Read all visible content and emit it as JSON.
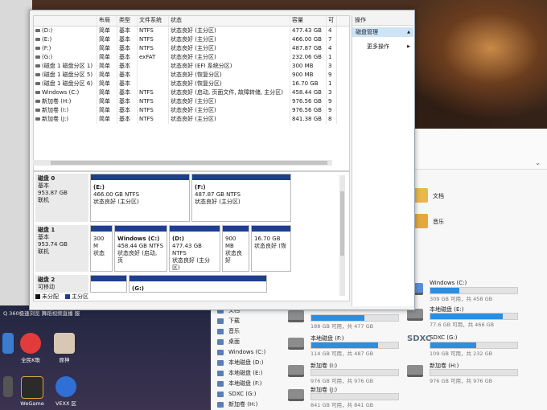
{
  "volumes": {
    "columns": [
      "",
      "布局",
      "类型",
      "文件系统",
      "状态",
      "容量",
      "可"
    ],
    "rows": [
      [
        "(D:)",
        "简单",
        "基本",
        "NTFS",
        "状态良好 (主分区)",
        "477.43 GB",
        "4"
      ],
      [
        "(E:)",
        "简单",
        "基本",
        "NTFS",
        "状态良好 (主分区)",
        "466.00 GB",
        "7"
      ],
      [
        "(F:)",
        "简单",
        "基本",
        "NTFS",
        "状态良好 (主分区)",
        "487.87 GB",
        "4"
      ],
      [
        "(G:)",
        "简单",
        "基本",
        "exFAT",
        "状态良好 (主分区)",
        "232.06 GB",
        "1"
      ],
      [
        "(磁盘 1 磁盘分区 1)",
        "简单",
        "基本",
        "",
        "状态良好 (EFI 系统分区)",
        "300 MB",
        "3"
      ],
      [
        "(磁盘 1 磁盘分区 5)",
        "简单",
        "基本",
        "",
        "状态良好 (恢复分区)",
        "900 MB",
        "9"
      ],
      [
        "(磁盘 1 磁盘分区 6)",
        "简单",
        "基本",
        "",
        "状态良好 (恢复分区)",
        "16.70 GB",
        "1"
      ],
      [
        "Windows (C:)",
        "简单",
        "基本",
        "NTFS",
        "状态良好 (启动, 页面文件, 故障转储, 主分区)",
        "458.44 GB",
        "3"
      ],
      [
        "新加卷 (H:)",
        "简单",
        "基本",
        "NTFS",
        "状态良好 (主分区)",
        "976.56 GB",
        "9"
      ],
      [
        "新加卷 (I:)",
        "简单",
        "基本",
        "NTFS",
        "状态良好 (主分区)",
        "976.56 GB",
        "9"
      ],
      [
        "新加卷 (J:)",
        "简单",
        "基本",
        "NTFS",
        "状态良好 (主分区)",
        "841.38 GB",
        "8"
      ]
    ]
  },
  "ops": {
    "header": "操作",
    "selected": "磁盘管理",
    "more": "更多操作"
  },
  "disks": {
    "d0": {
      "name": "磁盘 0",
      "type": "基本",
      "size": "953.87 GB",
      "status": "联机",
      "p1": {
        "label": "(E:)",
        "size": "466.00 GB NTFS",
        "status": "状态良好 (主分区)"
      },
      "p2": {
        "label": "(F:)",
        "size": "487.87 GB NTFS",
        "status": "状态良好 (主分区)"
      }
    },
    "d1": {
      "name": "磁盘 1",
      "type": "基本",
      "size": "953.74 GB",
      "status": "联机",
      "p1": {
        "size": "300 M",
        "status": "状态"
      },
      "p2": {
        "label": "Windows (C:)",
        "size": "458.44 GB NTFS",
        "status": "状态良好 (启动, 页"
      },
      "p3": {
        "label": "(D:)",
        "size": "477.43 GB NTFS",
        "status": "状态良好 (主分区)"
      },
      "p4": {
        "size": "900 MB",
        "status": "状态良好"
      },
      "p5": {
        "size": "16.70 GB",
        "status": "状态良好 (恢"
      }
    },
    "d2": {
      "name": "磁盘 2",
      "type": "可移动",
      "p1": {
        "label": "(G:)"
      }
    },
    "legend": {
      "unalloc": "未分配",
      "primary": "主分区"
    }
  },
  "explorer": {
    "folders": [
      "文档",
      "音乐"
    ],
    "nav": [
      "文档",
      "下载",
      "音乐",
      "桌面",
      "Windows (C:)",
      "本地磁盘 (D:)",
      "本地磁盘 (E:)",
      "本地磁盘 (F:)",
      "SDXC (G:)",
      "新加卷 (H:)"
    ],
    "drives": [
      {
        "name": "Windows (C:)",
        "free": "309 GB 可用，共 458 GB",
        "fill": 0.33
      },
      {
        "name": "本地磁盘 (E:)",
        "free": "77.6 GB 可用，共 466 GB",
        "fill": 0.83
      },
      {
        "name": "",
        "free": "188 GB 可用，共 477 GB",
        "fill": 0.61
      },
      {
        "name": "SDXC (G:)",
        "free": "109 GB 可用，共 232 GB",
        "fill": 0.53
      },
      {
        "name": "本地磁盘 (F:)",
        "free": "114 GB 可用，共 487 GB",
        "fill": 0.77
      },
      {
        "name": "新加卷 (H:)",
        "free": "976 GB 可用，共 976 GB",
        "fill": 0.0
      },
      {
        "name": "新加卷 (I:)",
        "free": "976 GB 可用，共 976 GB",
        "fill": 0.0
      },
      {
        "name": "新加卷 (J:)",
        "free": "841 GB 可用，共 841 GB",
        "fill": 0.0
      }
    ],
    "sdxc_label": "SDXC"
  },
  "desktop": {
    "search_hint": "Q 360极速浏览 舞蹈视频直播 服",
    "icons": [
      "",
      "全民K歌",
      "原神",
      "",
      "WeGame",
      "VEXX 区"
    ]
  },
  "colors": {
    "primary": "#1e3f8a",
    "drive_fill": "#2d8ee0",
    "selection": "#cde4f7"
  }
}
